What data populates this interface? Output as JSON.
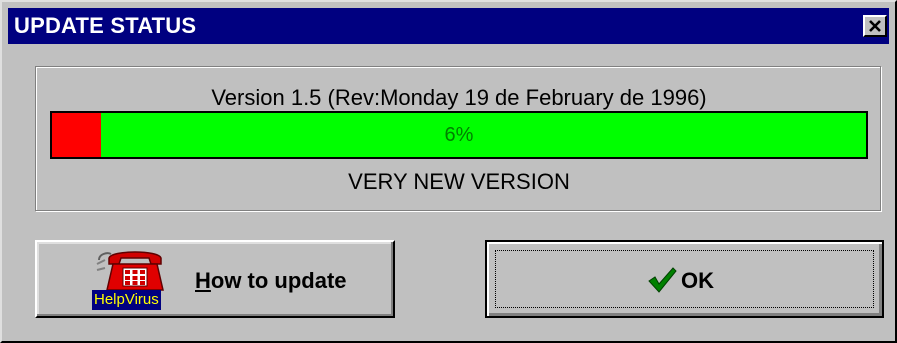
{
  "window": {
    "title": "UPDATE STATUS",
    "close_icon": "close-icon"
  },
  "status_panel": {
    "version_text": "Version 1.5 (Rev:Monday 19 de February de 1996)",
    "progress": {
      "value_percent": 6,
      "label": "6%",
      "fill_color": "#ff0000",
      "track_color": "#00ff00",
      "label_color": "#008000"
    },
    "status_text": "VERY NEW VERSION"
  },
  "buttons": {
    "how_to_update": {
      "label_underlined": "H",
      "label_rest": "ow to update",
      "icon": "phone-icon",
      "badge": "HelpVirus"
    },
    "ok": {
      "label": "OK",
      "icon": "check-icon"
    }
  },
  "colors": {
    "titlebar": "#000080",
    "face": "#c0c0c0"
  }
}
